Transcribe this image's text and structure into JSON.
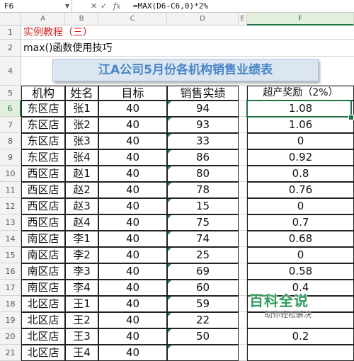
{
  "formula_bar": {
    "name_box": "F6",
    "fx_label": "fx",
    "formula": "=MAX(D6-C6,0)*2%"
  },
  "columns": [
    "A",
    "B",
    "C",
    "D",
    "E",
    "F"
  ],
  "rows": [
    "1",
    "2",
    "4",
    "5",
    "6",
    "7",
    "8",
    "9",
    "10",
    "11",
    "12",
    "13",
    "14",
    "15",
    "16",
    "17",
    "18",
    "19",
    "20",
    "21"
  ],
  "meta": {
    "tutorial_title": "实例教程（三）",
    "subtitle": "max()函数使用技巧",
    "report_title": "江A公司5月份各机构销售业绩表"
  },
  "table": {
    "headers": [
      "机构",
      "姓名",
      "目标",
      "销售实绩",
      "超产奖励（2%）"
    ],
    "rows": [
      [
        "东区店",
        "张1",
        "40",
        "94",
        "1.08"
      ],
      [
        "东区店",
        "张2",
        "40",
        "93",
        "1.06"
      ],
      [
        "东区店",
        "张3",
        "40",
        "33",
        "0"
      ],
      [
        "东区店",
        "张4",
        "40",
        "86",
        "0.92"
      ],
      [
        "西区店",
        "赵1",
        "40",
        "80",
        "0.8"
      ],
      [
        "西区店",
        "赵2",
        "40",
        "78",
        "0.76"
      ],
      [
        "西区店",
        "赵3",
        "40",
        "15",
        "0"
      ],
      [
        "西区店",
        "赵4",
        "40",
        "75",
        "0.7"
      ],
      [
        "南区店",
        "李1",
        "40",
        "74",
        "0.68"
      ],
      [
        "南区店",
        "李2",
        "40",
        "25",
        "0"
      ],
      [
        "南区店",
        "李3",
        "40",
        "69",
        "0.58"
      ],
      [
        "南区店",
        "李4",
        "40",
        "60",
        "0.4"
      ],
      [
        "北区店",
        "王1",
        "40",
        "59",
        ""
      ],
      [
        "北区店",
        "王2",
        "40",
        "22",
        ""
      ],
      [
        "北区店",
        "王3",
        "40",
        "50",
        "0.2"
      ],
      [
        "北区店",
        "王4",
        "40",
        "",
        ""
      ]
    ]
  },
  "watermark": {
    "title": "百科全说",
    "subtitle": "助你轻松解决"
  },
  "colors": {
    "accent": "#217346",
    "title_blue": "#4a86c8",
    "red_text": "#e02020",
    "watermark_green": "#2e9c5b"
  }
}
